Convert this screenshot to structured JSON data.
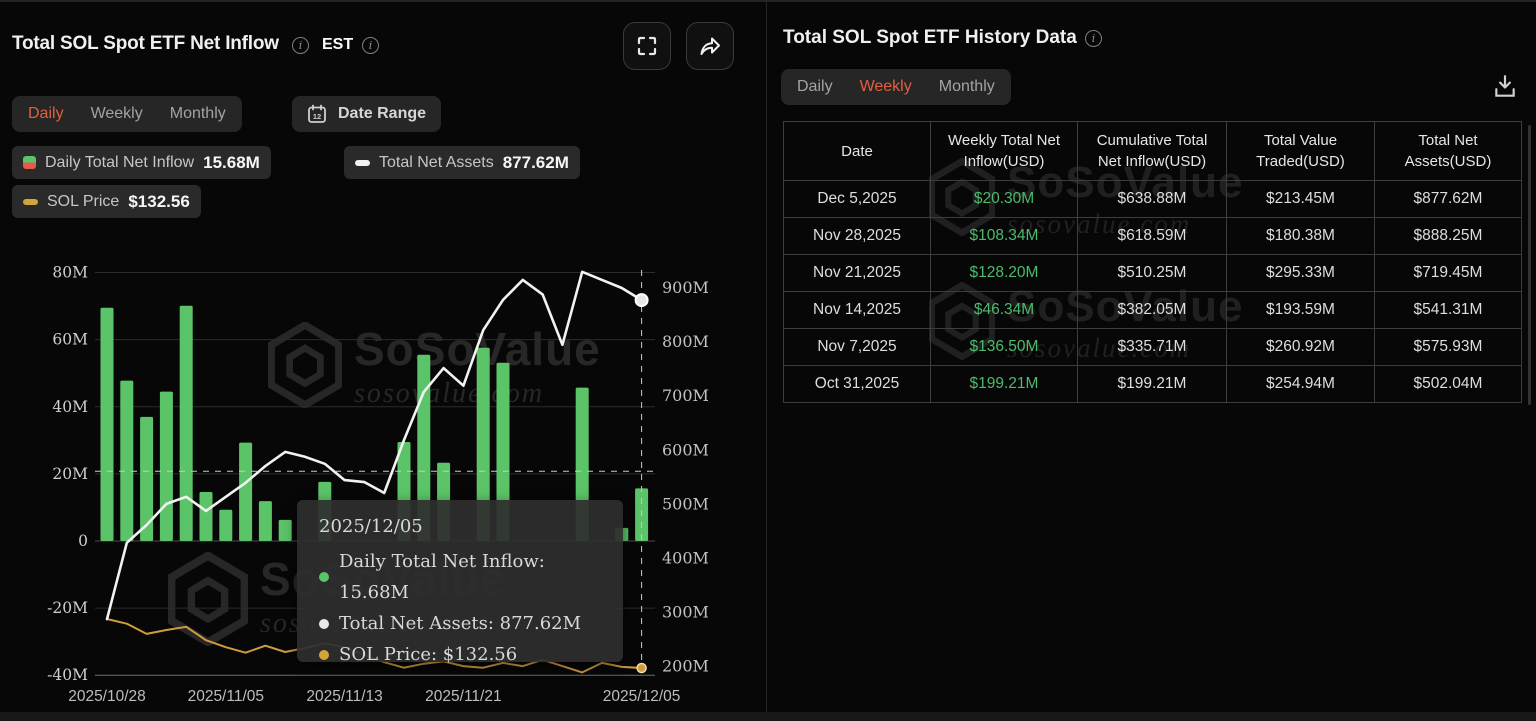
{
  "watermark": {
    "brand": "SoSoValue",
    "domain": "sosovalue.com"
  },
  "left_panel": {
    "title": "Total SOL Spot ETF Net Inflow",
    "timezone_label": "EST",
    "tabs": {
      "items": [
        "Daily",
        "Weekly",
        "Monthly"
      ],
      "active": "Daily"
    },
    "date_range_label": "Date Range",
    "legend": [
      {
        "label": "Daily Total Net Inflow",
        "value": "15.68M",
        "icon_top_color": "#5cc468",
        "icon_bottom_color": "#e25b4d"
      },
      {
        "label": "Total Net Assets",
        "value": "877.62M",
        "icon_color": "#f2f2f2"
      },
      {
        "label": "SOL Price",
        "value": "$132.56",
        "icon_color": "#d4a43c"
      }
    ],
    "tooltip": {
      "date": "2025/12/05",
      "rows": [
        {
          "color": "#5cc468",
          "text": "Daily Total Net Inflow: 15.68M"
        },
        {
          "color": "#e9e9e9",
          "text": "Total Net Assets: 877.62M"
        },
        {
          "color": "#d4a43c",
          "text": "SOL Price: $132.56"
        }
      ]
    }
  },
  "chart_data": {
    "type": "mixed bar+line",
    "x": [
      "2025/10/28",
      "2025/10/29",
      "2025/10/30",
      "2025/10/31",
      "2025/11/03",
      "2025/11/04",
      "2025/11/05",
      "2025/11/06",
      "2025/11/07",
      "2025/11/10",
      "2025/11/11",
      "2025/11/12",
      "2025/11/13",
      "2025/11/14",
      "2025/11/17",
      "2025/11/18",
      "2025/11/19",
      "2025/11/20",
      "2025/11/21",
      "2025/11/24",
      "2025/11/25",
      "2025/11/26",
      "2025/11/28",
      "2025/12/01",
      "2025/12/02",
      "2025/12/03",
      "2025/12/04",
      "2025/12/05"
    ],
    "x_ticks": [
      {
        "index": 0,
        "label": "2025/10/28"
      },
      {
        "index": 6,
        "label": "2025/11/05"
      },
      {
        "index": 12,
        "label": "2025/11/13"
      },
      {
        "index": 18,
        "label": "2025/11/21"
      },
      {
        "index": 27,
        "label": "2025/12/05"
      }
    ],
    "left_axis": {
      "unit": "M USD",
      "range": [
        -40,
        80
      ],
      "ticks": [
        {
          "value": 80,
          "label": "80M"
        },
        {
          "value": 60,
          "label": "60M"
        },
        {
          "value": 40,
          "label": "40M"
        },
        {
          "value": 20,
          "label": "20M"
        },
        {
          "value": 0,
          "label": "0"
        },
        {
          "value": -20,
          "label": "-20M"
        },
        {
          "value": -40,
          "label": "-40M"
        }
      ]
    },
    "right_axis": {
      "unit": "M USD",
      "range": [
        200,
        900
      ],
      "ticks": [
        {
          "value": 900,
          "label": "900M"
        },
        {
          "value": 800,
          "label": "800M"
        },
        {
          "value": 700,
          "label": "700M"
        },
        {
          "value": 600,
          "label": "600M"
        },
        {
          "value": 500,
          "label": "500M"
        },
        {
          "value": 400,
          "label": "400M"
        },
        {
          "value": 300,
          "label": "300M"
        },
        {
          "value": 200,
          "label": "200M"
        }
      ]
    },
    "series": [
      {
        "name": "Daily Total Net Inflow",
        "type": "bar",
        "axis": "left",
        "unit": "M USD",
        "color": "#5cc468",
        "values": [
          69.5,
          47.8,
          37.0,
          44.5,
          70.1,
          14.6,
          9.3,
          29.3,
          11.9,
          6.3,
          0,
          17.6,
          0,
          0,
          0,
          29.5,
          55.5,
          23.3,
          0,
          57.6,
          53.1,
          0,
          0,
          0,
          45.7,
          0,
          3.9,
          15.68
        ]
      },
      {
        "name": "Total Net Assets",
        "type": "line",
        "axis": "right",
        "unit": "M USD",
        "color": "#f2f2f2",
        "values": [
          288,
          429,
          462,
          501,
          514,
          488,
          514,
          540,
          571,
          597,
          588,
          575,
          545,
          541.31,
          521,
          619,
          708,
          752,
          719.45,
          822,
          878,
          915,
          888.25,
          795,
          930,
          915,
          900,
          877.62
        ]
      },
      {
        "name": "SOL Price",
        "type": "line",
        "axis": "hidden-price",
        "unit": "USD",
        "color": "#d29b3f",
        "values": [
          195,
          189,
          176,
          181,
          185,
          168,
          159,
          152,
          161,
          153,
          158,
          164,
          159,
          149,
          140,
          133,
          138,
          141,
          135,
          133,
          139,
          135,
          143,
          135,
          127,
          139,
          134,
          132.56
        ]
      }
    ],
    "crosshair": {
      "x_index": 27,
      "h_line_left_axis_value": 20.8
    },
    "title": "Total SOL Spot ETF Net Inflow",
    "legend_position": "top-left",
    "grid": true
  },
  "right_panel": {
    "title": "Total SOL Spot ETF History Data",
    "tabs": {
      "items": [
        "Daily",
        "Weekly",
        "Monthly"
      ],
      "active": "Weekly"
    },
    "table": {
      "headers": [
        "Date",
        "Weekly Total Net\nInflow(USD)",
        "Cumulative Total\nNet Inflow(USD)",
        "Total Value\nTraded(USD)",
        "Total Net\nAssets(USD)"
      ],
      "rows": [
        [
          "Dec 5,2025",
          "$20.30M",
          "$638.88M",
          "$213.45M",
          "$877.62M"
        ],
        [
          "Nov 28,2025",
          "$108.34M",
          "$618.59M",
          "$180.38M",
          "$888.25M"
        ],
        [
          "Nov 21,2025",
          "$128.20M",
          "$510.25M",
          "$295.33M",
          "$719.45M"
        ],
        [
          "Nov 14,2025",
          "$46.34M",
          "$382.05M",
          "$193.59M",
          "$541.31M"
        ],
        [
          "Nov 7,2025",
          "$136.50M",
          "$335.71M",
          "$260.92M",
          "$575.93M"
        ],
        [
          "Oct 31,2025",
          "$199.21M",
          "$199.21M",
          "$254.94M",
          "$502.04M"
        ]
      ]
    }
  },
  "colors": {
    "accent_orange": "#e2603c",
    "bar_green": "#5cc468",
    "table_green": "#4cbb6c",
    "assets_line": "#f2f2f2",
    "price_line": "#d29b3f",
    "legend_red": "#e25b4d",
    "panel_bg": "#070707",
    "chip_bg": "#2a2a2a"
  }
}
